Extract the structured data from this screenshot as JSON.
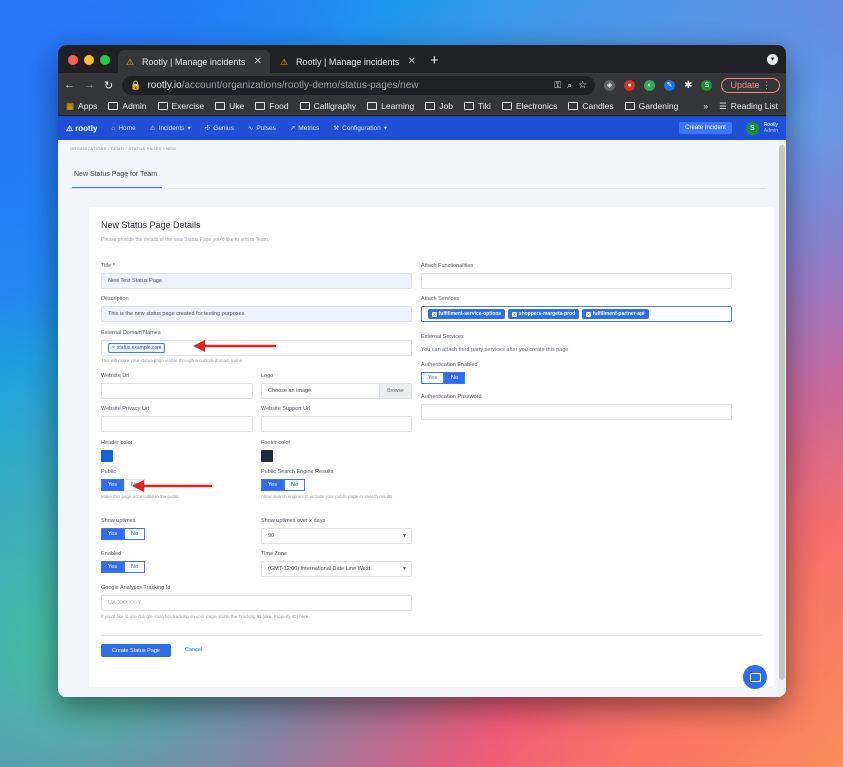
{
  "browser": {
    "tabs": [
      {
        "title": "Rootly | Manage incidents direc",
        "active": true
      },
      {
        "title": "Rootly | Manage incidents direc",
        "active": false
      }
    ],
    "url_host": "rootly.io",
    "url_path": "/account/organizations/rootly-demo/status-pages/new",
    "update_label": "Update",
    "profile_initial": "S",
    "bookmarks": [
      "Apps",
      "Admin",
      "Exercise",
      "Uke",
      "Food",
      "Calligraphy",
      "Learning",
      "Job",
      "Tiki",
      "Electronics",
      "Candles",
      "Gardening"
    ],
    "more_bookmarks": "»",
    "reading_list": "Reading List"
  },
  "app": {
    "brand": "rootly",
    "nav": [
      "Home",
      "Incidents",
      "Genius",
      "Pulses",
      "Metrics",
      "Configuration"
    ],
    "create_incident": "Create Incident",
    "user_initial": "S",
    "user_name": "Rootly",
    "user_sub": "Admin"
  },
  "page": {
    "breadcrumb": "ORGANIZATIONS  /  DEMO  /  STATUS PAGES  /  NEW",
    "title": "New Status Page for Team"
  },
  "form": {
    "heading": "New Status Page Details",
    "subheading": "Please provide the details of the new Status Page you'd like to add to Team.",
    "title_label": "Title *",
    "title_value": "New Test Status Page",
    "description_label": "Description",
    "description_value": "This is the new status page created for testing purposes",
    "domain_label": "External Domain Names",
    "domain_chip": "status.example.com",
    "domain_help": "This will make your status page visible through a custom domain name.",
    "website_url_label": "Website Url",
    "logo_label": "Logo",
    "logo_placeholder": "Choose an image",
    "browse_label": "Browse",
    "privacy_url_label": "Website Privacy Url",
    "support_url_label": "Website Support Url",
    "header_color_label": "Header color",
    "header_color": "#1763d6",
    "footer_color_label": "Footer color",
    "footer_color": "#1f2937",
    "public_label": "Public",
    "public_help": "Make this page accessible to the public",
    "search_label": "Public Search Engine Results",
    "search_help": "Allow search engines to include your public page in search results",
    "uptimes_label": "Show uptimes",
    "uptime_days_label": "Show uptimes over x days",
    "uptime_days_value": "90",
    "enabled_label": "Enabled",
    "timezone_label": "Time Zone",
    "timezone_value": "(GMT-12:00) International Date Line West",
    "ga_label": "Google Analytics Tracking Id",
    "ga_placeholder": "UA-XXXXX-Y",
    "ga_help": "If you'd like to use Google Analytics tracking on your page, paste the Tracking ID (aka. Property ID) here",
    "yes": "Yes",
    "no": "No",
    "functionalities_label": "Attach Functionalities",
    "services_label": "Attach Services",
    "services": [
      "fulfillment-service-options",
      "shoppers-margeta-prod",
      "fulfillment-partner-api"
    ],
    "external_services_label": "External Services",
    "external_services_text": "You can attach third party services after you create this page",
    "auth_enabled_label": "Authentication Enabled",
    "auth_password_label": "Authentication Password",
    "create_button": "Create Status Page",
    "cancel_button": "Cancel",
    "chip_remove": "×"
  }
}
